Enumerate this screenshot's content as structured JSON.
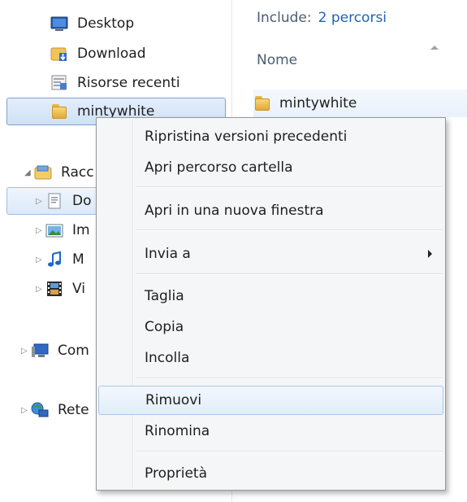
{
  "navigation": {
    "items": [
      {
        "label": "Desktop",
        "icon": "desktop-icon"
      },
      {
        "label": "Download",
        "icon": "download-folder-icon"
      },
      {
        "label": "Risorse recenti",
        "icon": "recent-places-icon"
      },
      {
        "label": "mintywhite",
        "icon": "folder-icon",
        "selected": true
      },
      {
        "label": "Racc",
        "icon": "libraries-icon"
      },
      {
        "label": "Do",
        "icon": "documents-icon"
      },
      {
        "label": "Im",
        "icon": "pictures-icon"
      },
      {
        "label": "M",
        "icon": "music-icon"
      },
      {
        "label": "Vi",
        "icon": "videos-icon"
      },
      {
        "label": "Com",
        "icon": "computer-icon"
      },
      {
        "label": "Rete",
        "icon": "network-icon"
      }
    ]
  },
  "content": {
    "include_label": "Include:",
    "include_link": "2 percorsi",
    "column_name": "Nome",
    "file": {
      "label": "mintywhite",
      "icon": "folder-icon"
    }
  },
  "context_menu": {
    "items": [
      "Ripristina versioni precedenti",
      "Apri percorso cartella",
      "Apri in una nuova finestra",
      "Invia a",
      "Taglia",
      "Copia",
      "Incolla",
      "Rimuovi",
      "Rinomina",
      "Proprietà"
    ],
    "highlighted": "Rimuovi",
    "submenu_item": "Invia a"
  },
  "colors": {
    "selection_border": "#7da2ce",
    "link": "#1f64b8",
    "menu_background": "#f5f6f8"
  }
}
